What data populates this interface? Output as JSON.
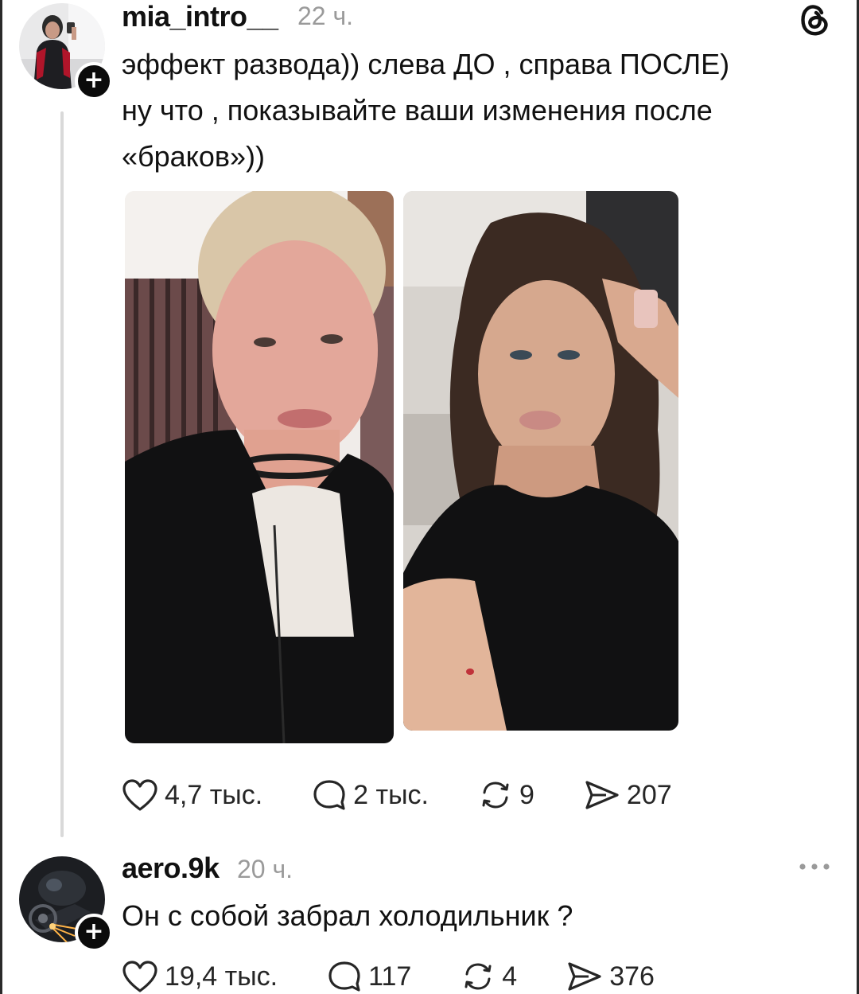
{
  "post": {
    "username": "mia_intro__",
    "time": "22 ч.",
    "text_line1": "эффект развода)) слева ДО , справа ПОСЛЕ)",
    "text_line2": "ну что , показывайте ваши изменения после",
    "text_line3": "«браков»))",
    "likes": "4,7 тыс.",
    "comments": "2 тыс.",
    "reposts": "9",
    "shares": "207"
  },
  "reply": {
    "username": "aero.9k",
    "time": "20 ч.",
    "text": "Он с собой забрал холодильник ?",
    "likes": "19,4 тыс.",
    "comments": "117",
    "reposts": "4",
    "shares": "376"
  },
  "icons": {
    "app_logo": "threads-logo-icon",
    "follow": "plus-icon",
    "like": "heart-icon",
    "comment": "comment-bubble-icon",
    "repost": "repost-icon",
    "share": "send-icon",
    "more": "more-dots-icon"
  },
  "colors": {
    "text": "#111111",
    "muted": "#9a9a9a",
    "thread_line": "#d9d9d9",
    "badge": "#0b0b0b"
  }
}
